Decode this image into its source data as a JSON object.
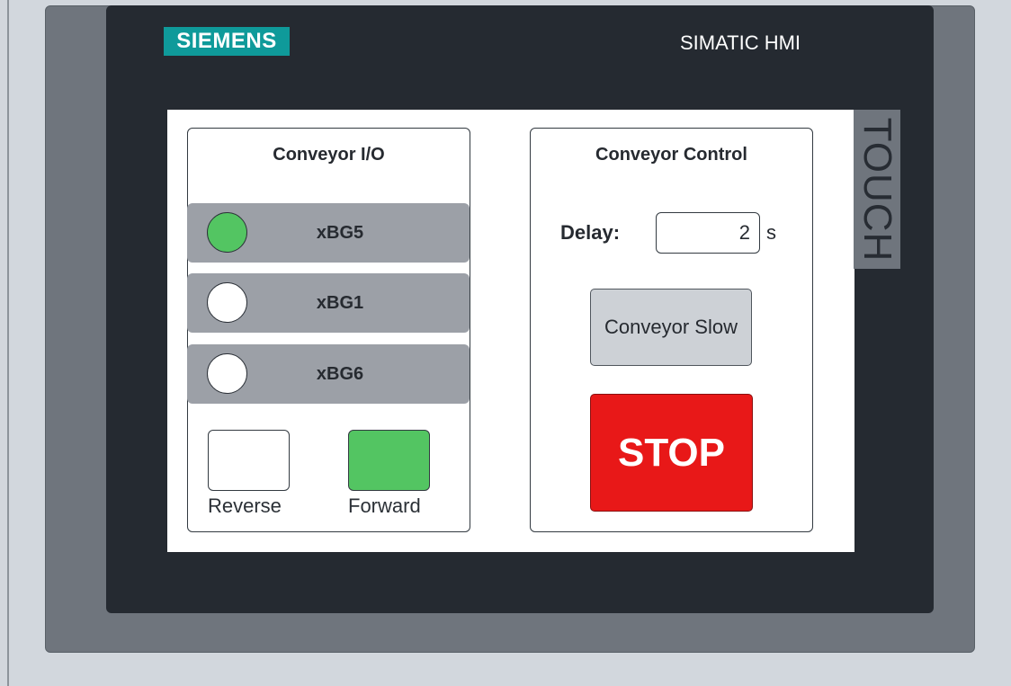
{
  "device": {
    "brand_logo": "SIEMENS",
    "model_label": "SIMATIC HMI",
    "touch_label": "TOUCH",
    "colors": {
      "brand_teal": "#0f9a9a",
      "bezel_dark": "#252a31",
      "frame_gray": "#6f757d"
    }
  },
  "io_panel": {
    "title": "Conveyor I/O",
    "signals": [
      {
        "label": "xBG5",
        "state": "on",
        "color": "#53c562"
      },
      {
        "label": "xBG1",
        "state": "off",
        "color": "#ffffff"
      },
      {
        "label": "xBG6",
        "state": "off",
        "color": "#ffffff"
      }
    ],
    "direction": {
      "reverse": {
        "label": "Reverse",
        "state": "off"
      },
      "forward": {
        "label": "Forward",
        "state": "on",
        "color": "#53c562"
      }
    }
  },
  "control_panel": {
    "title": "Conveyor Control",
    "delay": {
      "label": "Delay:",
      "value": "2",
      "unit": "s"
    },
    "slow_button_label": "Conveyor Slow",
    "stop_button_label": "STOP",
    "stop_color": "#e81818"
  }
}
